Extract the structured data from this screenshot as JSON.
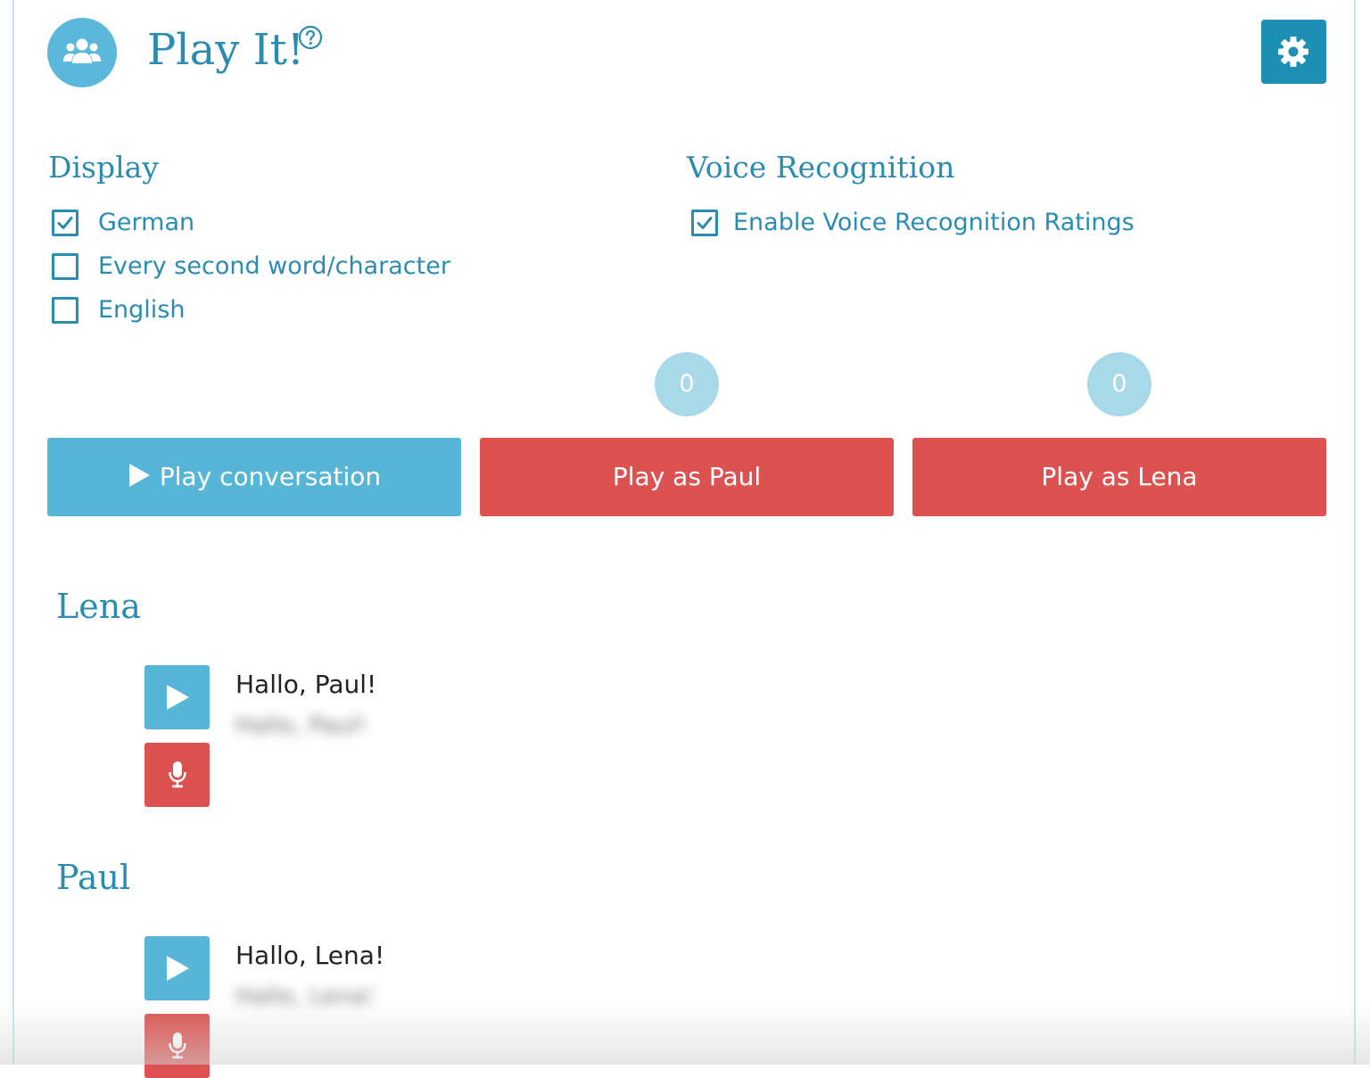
{
  "header": {
    "title": "Play It!",
    "help_icon": "question-circle-icon",
    "avatar_icon": "users-icon",
    "settings_icon": "gear-icon"
  },
  "display": {
    "heading": "Display",
    "options": [
      {
        "label": "German",
        "checked": true
      },
      {
        "label": "Every second word/character",
        "checked": false
      },
      {
        "label": "English",
        "checked": false
      }
    ]
  },
  "voice_recognition": {
    "heading": "Voice Recognition",
    "option": {
      "label": "Enable Voice Recognition Ratings",
      "checked": true
    }
  },
  "scores": {
    "paul": "0",
    "lena": "0"
  },
  "actions": {
    "play_conversation": "Play conversation",
    "play_as_paul": "Play as Paul",
    "play_as_lena": "Play as Lena"
  },
  "dialogue": [
    {
      "speaker": "Lena",
      "text": "Hallo, Paul!",
      "translation": "Hallo, Paul!"
    },
    {
      "speaker": "Paul",
      "text": "Hallo, Lena!",
      "translation": "Hallo, Lena!"
    }
  ],
  "colors": {
    "primary_text": "#2b8cb1",
    "play_blue": "#57b5d7",
    "settings_blue": "#1d8fb5",
    "record_red": "#dc5250",
    "score_badge": "#a8d9e8"
  }
}
